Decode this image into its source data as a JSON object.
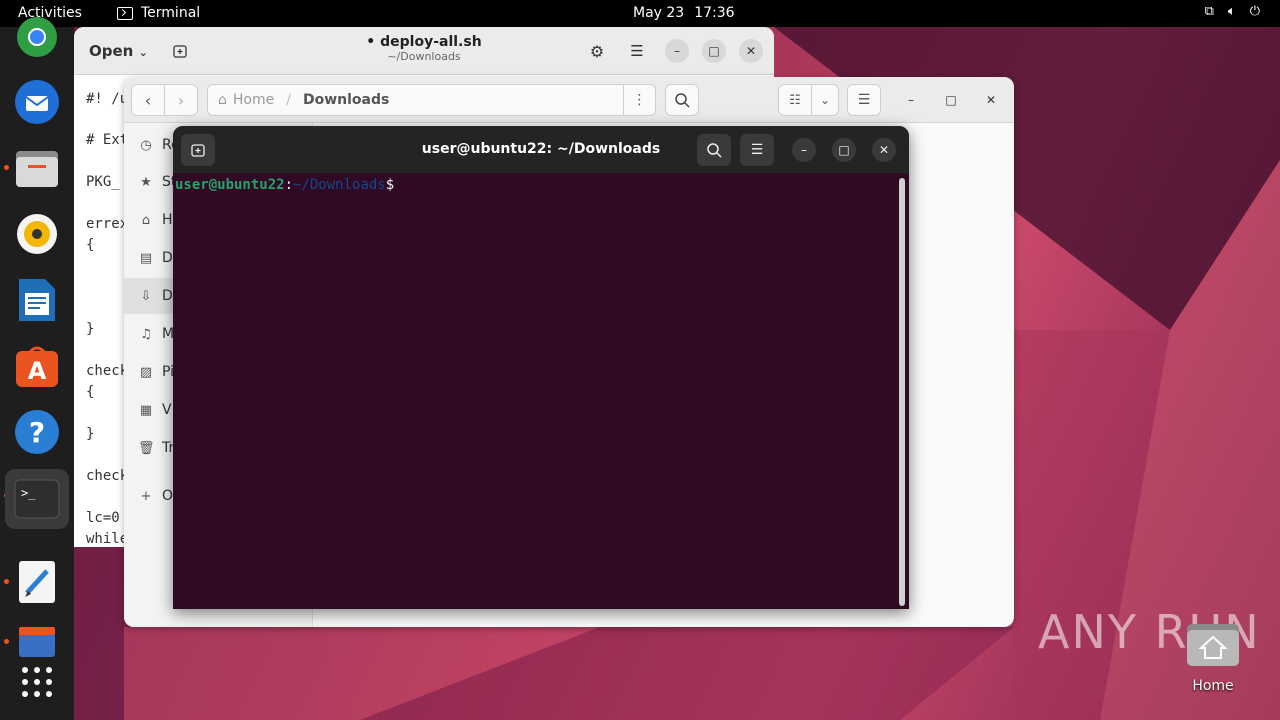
{
  "topbar": {
    "activities": "Activities",
    "app_name": "Terminal",
    "date": "May 23",
    "time": "17:36"
  },
  "dock": {
    "items": [
      "chrome",
      "thunderbird",
      "files",
      "rhythmbox",
      "libreoffice-writer",
      "app-center",
      "help",
      "terminal",
      "text-editor",
      "file-roller",
      "show-apps"
    ]
  },
  "editor": {
    "open_label": "Open",
    "title": "• deploy-all.sh",
    "subtitle": "~/Downloads",
    "code_lines": [
      "#! /u",
      "# Ext",
      "PKG_",
      "errex",
      "{",
      "}",
      "check",
      "{",
      "}",
      "check",
      "lc=0",
      "while"
    ]
  },
  "files": {
    "path_home": "Home",
    "path_sep": "/",
    "path_current": "Downloads",
    "sidebar": [
      {
        "icon": "clock-icon",
        "label": "Re"
      },
      {
        "icon": "star-icon",
        "label": "St"
      },
      {
        "icon": "home-icon",
        "label": "H"
      },
      {
        "icon": "document-icon",
        "label": "D"
      },
      {
        "icon": "download-icon",
        "label": "D"
      },
      {
        "icon": "music-icon",
        "label": "M"
      },
      {
        "icon": "picture-icon",
        "label": "Pi"
      },
      {
        "icon": "video-icon",
        "label": "V"
      },
      {
        "icon": "trash-icon",
        "label": "Tr"
      },
      {
        "icon": "plus-icon",
        "label": "O"
      }
    ]
  },
  "terminal": {
    "title": "user@ubuntu22: ~/Downloads",
    "prompt_user": "user@ubuntu22",
    "prompt_colon": ":",
    "prompt_path": "~/Downloads",
    "prompt_dollar": "$"
  },
  "desktop": {
    "home_label": "Home",
    "watermark": "ANY RUN"
  },
  "colors": {
    "terminal_bg": "#300a24",
    "prompt_user": "#26a269",
    "prompt_path": "#12488b",
    "accent": "#e95420"
  }
}
